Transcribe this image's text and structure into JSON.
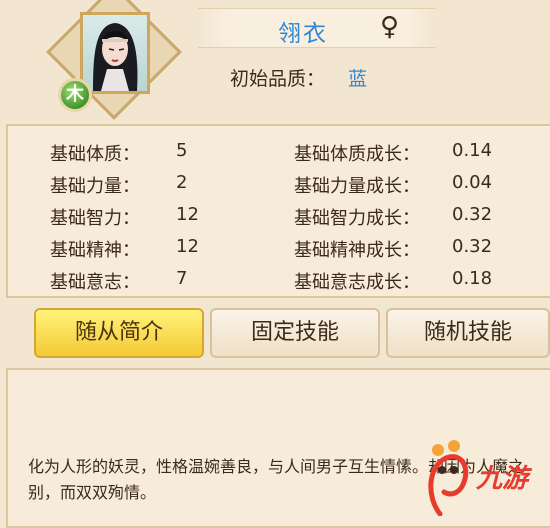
{
  "character": {
    "name": "翎衣",
    "gender_symbol": "♀",
    "element_badge": "木",
    "quality_label": "初始品质：",
    "quality_value": "蓝",
    "colors": {
      "name": "#2f87d6",
      "quality": "#2f87d6",
      "element": "#3f8e2a"
    }
  },
  "stats": {
    "left": [
      {
        "label": "基础体质：",
        "value": "5"
      },
      {
        "label": "基础力量：",
        "value": "2"
      },
      {
        "label": "基础智力：",
        "value": "12"
      },
      {
        "label": "基础精神：",
        "value": "12"
      },
      {
        "label": "基础意志：",
        "value": "7"
      }
    ],
    "right": [
      {
        "label": "基础体质成长：",
        "value": "0.14"
      },
      {
        "label": "基础力量成长：",
        "value": "0.04"
      },
      {
        "label": "基础智力成长：",
        "value": "0.32"
      },
      {
        "label": "基础精神成长：",
        "value": "0.32"
      },
      {
        "label": "基础意志成长：",
        "value": "0.18"
      }
    ]
  },
  "tabs": [
    {
      "label": "随从简介",
      "active": true
    },
    {
      "label": "固定技能",
      "active": false
    },
    {
      "label": "随机技能",
      "active": false
    }
  ],
  "description": "化为人形的妖灵，性格温婉善良，与人间男子互生情愫。却因为人魔之别，而双双殉情。",
  "watermark": {
    "text": "九游"
  }
}
